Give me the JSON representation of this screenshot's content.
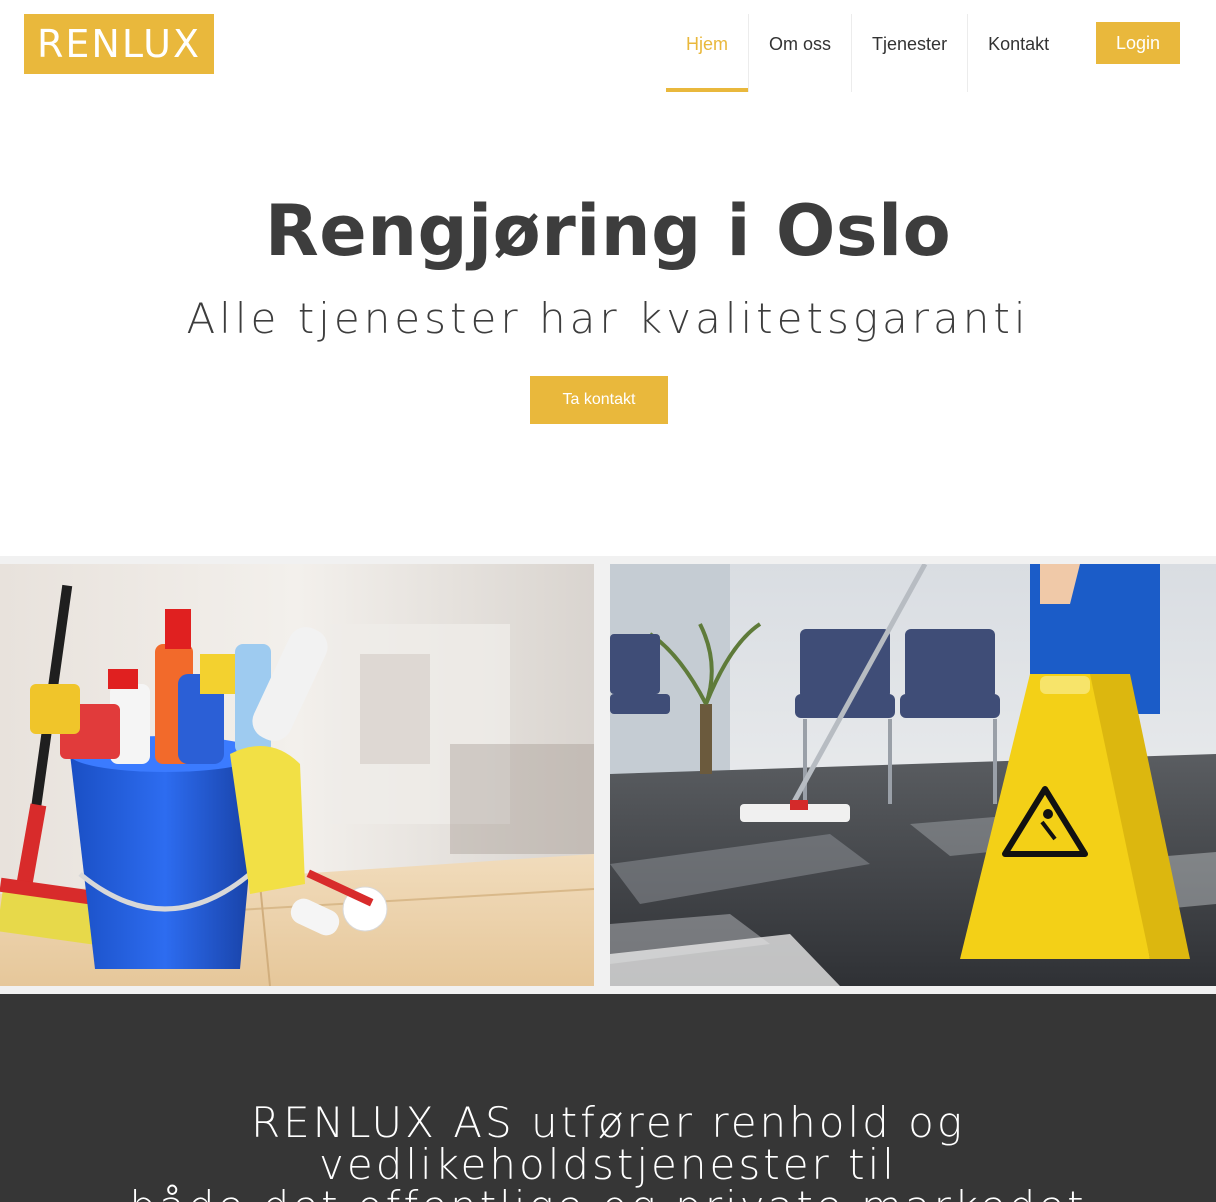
{
  "logo": {
    "text": "RENLUX"
  },
  "nav": {
    "items": [
      {
        "label": "Hjem",
        "active": true
      },
      {
        "label": "Om oss",
        "active": false
      },
      {
        "label": "Tjenester",
        "active": false
      },
      {
        "label": "Kontakt",
        "active": false
      }
    ],
    "login_label": "Login"
  },
  "hero": {
    "title": "Rengjøring i Oslo",
    "subtitle": "Alle tjenester har kvalitetsgaranti",
    "cta_label": "Ta kontakt"
  },
  "images": {
    "left": "cleaning-supplies-bucket-photo",
    "right": "mopping-floor-wet-sign-photo"
  },
  "about": {
    "line1": "RENLUX AS utfører renhold og vedlikeholdstjenester til",
    "line2": "både det offentlige og private markedet"
  },
  "colors": {
    "accent": "#e9b83c",
    "dark": "#363636",
    "text": "#3d3d3d"
  }
}
